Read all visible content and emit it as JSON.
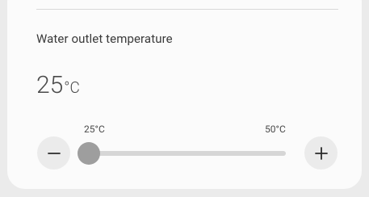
{
  "setting": {
    "label": "Water outlet temperature",
    "value": "25",
    "unit": "°C",
    "range_min_label": "25°C",
    "range_max_label": "50°C",
    "slider": {
      "min": 25,
      "max": 50,
      "current": 25
    }
  },
  "controls": {
    "decrease_icon": "minus-icon",
    "increase_icon": "plus-icon"
  },
  "colors": {
    "card_bg": "#fbfbfb",
    "page_bg": "#ebebeb",
    "thumb": "#9e9e9e",
    "track": "#d6d6d6"
  }
}
